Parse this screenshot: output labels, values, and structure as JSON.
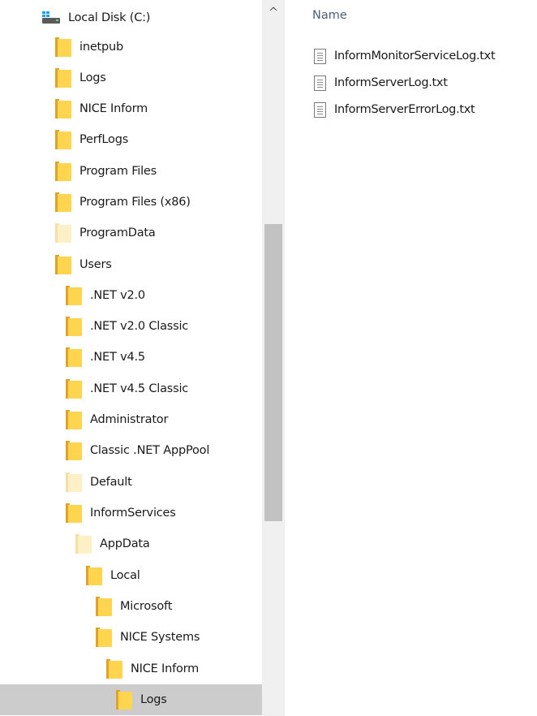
{
  "nav_tree": {
    "drive": {
      "label": "Local Disk (C:)",
      "icon": "drive-icon"
    },
    "items": [
      {
        "label": "inetpub",
        "faded": false,
        "selected": false
      },
      {
        "label": "Logs",
        "faded": false,
        "selected": false
      },
      {
        "label": "NICE Inform",
        "faded": false,
        "selected": false
      },
      {
        "label": "PerfLogs",
        "faded": false,
        "selected": false
      },
      {
        "label": "Program Files",
        "faded": false,
        "selected": false
      },
      {
        "label": "Program Files (x86)",
        "faded": false,
        "selected": false
      },
      {
        "label": "ProgramData",
        "faded": true,
        "selected": false
      },
      {
        "label": "Users",
        "faded": false,
        "selected": false
      },
      {
        "label": ".NET v2.0",
        "faded": false,
        "selected": false
      },
      {
        "label": ".NET v2.0 Classic",
        "faded": false,
        "selected": false
      },
      {
        "label": ".NET v4.5",
        "faded": false,
        "selected": false
      },
      {
        "label": ".NET v4.5 Classic",
        "faded": false,
        "selected": false
      },
      {
        "label": "Administrator",
        "faded": false,
        "selected": false
      },
      {
        "label": "Classic .NET AppPool",
        "faded": false,
        "selected": false
      },
      {
        "label": "Default",
        "faded": true,
        "selected": false
      },
      {
        "label": "InformServices",
        "faded": false,
        "selected": false
      },
      {
        "label": "AppData",
        "faded": true,
        "selected": false
      },
      {
        "label": "Local",
        "faded": false,
        "selected": false
      },
      {
        "label": "Microsoft",
        "faded": false,
        "selected": false
      },
      {
        "label": "NICE Systems",
        "faded": false,
        "selected": false
      },
      {
        "label": "NICE Inform",
        "faded": false,
        "selected": false
      },
      {
        "label": "Logs",
        "faded": false,
        "selected": true
      }
    ]
  },
  "scrollbar": {
    "up_arrow": "^"
  },
  "content": {
    "column_header": "Name",
    "files": [
      {
        "label": "InformMonitorServiceLog.txt",
        "icon": "text-file-icon"
      },
      {
        "label": "InformServerLog.txt",
        "icon": "text-file-icon"
      },
      {
        "label": "InformServerErrorLog.txt",
        "icon": "text-file-icon"
      }
    ]
  },
  "colors": {
    "folder_front": "#ffd44f",
    "folder_back": "#e0a22a",
    "selection": "#cccccc",
    "header_text": "#4c607a"
  }
}
